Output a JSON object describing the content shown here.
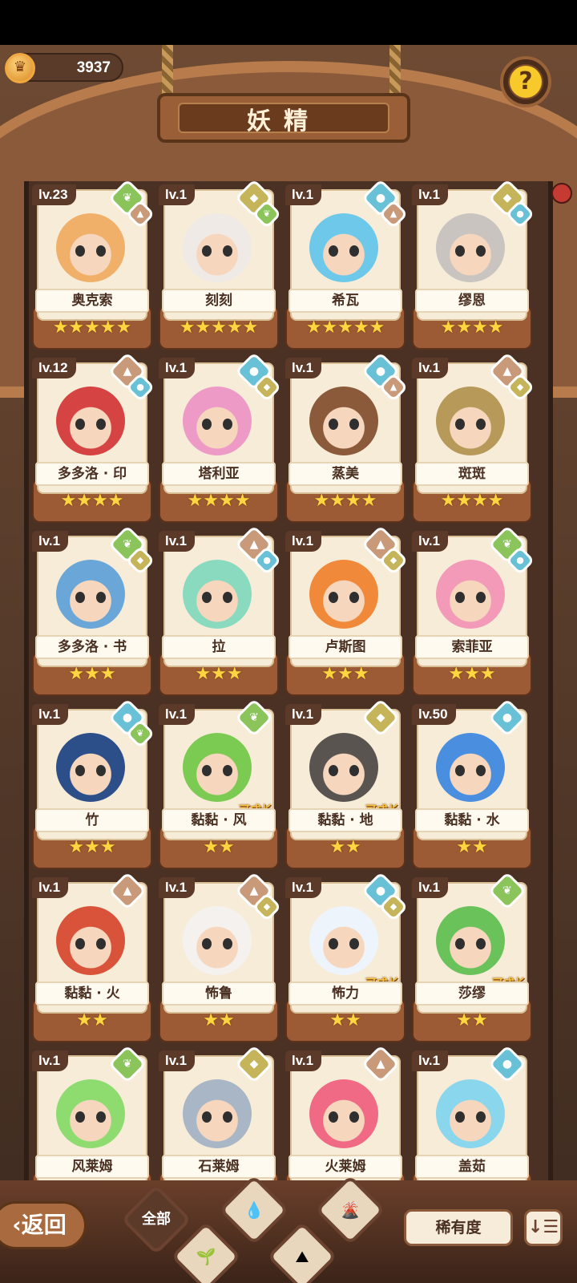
{
  "currency": {
    "amount": "3937",
    "icon": "coin-icon"
  },
  "header": {
    "title": "妖精"
  },
  "help": {
    "label": "?"
  },
  "cards": [
    {
      "name": "奥克索",
      "level": "lv.23",
      "stars": "★★★★★",
      "elements": [
        "wind",
        "fire"
      ],
      "grow": "",
      "color": "#f0b06a"
    },
    {
      "name": "刻刻",
      "level": "lv.1",
      "stars": "★★★★★",
      "elements": [
        "earth",
        "wind"
      ],
      "grow": "",
      "color": "#efeae6"
    },
    {
      "name": "希瓦",
      "level": "lv.1",
      "stars": "★★★★★",
      "elements": [
        "water",
        "fire"
      ],
      "grow": "",
      "color": "#6ec8ea"
    },
    {
      "name": "缪恩",
      "level": "lv.1",
      "stars": "★★★★",
      "elements": [
        "earth",
        "water"
      ],
      "grow": "",
      "color": "#c9c4bf"
    },
    {
      "name": "多多洛 · 印",
      "level": "lv.12",
      "stars": "★★★★",
      "elements": [
        "fire",
        "water"
      ],
      "grow": "",
      "color": "#d64343"
    },
    {
      "name": "塔利亚",
      "level": "lv.1",
      "stars": "★★★★",
      "elements": [
        "water",
        "earth"
      ],
      "grow": "",
      "color": "#ee9ac6"
    },
    {
      "name": "蒸美",
      "level": "lv.1",
      "stars": "★★★★",
      "elements": [
        "water",
        "fire"
      ],
      "grow": "",
      "color": "#8a5a3b"
    },
    {
      "name": "斑斑",
      "level": "lv.1",
      "stars": "★★★★",
      "elements": [
        "fire",
        "earth"
      ],
      "grow": "",
      "color": "#b79a5a"
    },
    {
      "name": "多多洛 · 书",
      "level": "lv.1",
      "stars": "★★★",
      "elements": [
        "wind",
        "earth"
      ],
      "grow": "",
      "color": "#6aa6d8"
    },
    {
      "name": "拉",
      "level": "lv.1",
      "stars": "★★★",
      "elements": [
        "fire",
        "water"
      ],
      "grow": "",
      "color": "#8adac0"
    },
    {
      "name": "卢斯图",
      "level": "lv.1",
      "stars": "★★★",
      "elements": [
        "fire",
        "earth"
      ],
      "grow": "",
      "color": "#f08a3a"
    },
    {
      "name": "索菲亚",
      "level": "lv.1",
      "stars": "★★★",
      "elements": [
        "wind",
        "water"
      ],
      "grow": "",
      "color": "#f29ab8"
    },
    {
      "name": "竹",
      "level": "lv.1",
      "stars": "★★★",
      "elements": [
        "water",
        "wind"
      ],
      "grow": "",
      "color": "#2c4f8a"
    },
    {
      "name": "黏黏 · 风",
      "level": "lv.1",
      "stars": "★★",
      "elements": [
        "wind"
      ],
      "grow": "可成长",
      "color": "#7bcb52"
    },
    {
      "name": "黏黏 · 地",
      "level": "lv.1",
      "stars": "★★",
      "elements": [
        "earth"
      ],
      "grow": "可成长",
      "color": "#5a5450"
    },
    {
      "name": "黏黏 · 水",
      "level": "lv.50",
      "stars": "★★",
      "elements": [
        "water"
      ],
      "grow": "",
      "color": "#4a8ee0"
    },
    {
      "name": "黏黏 · 火",
      "level": "lv.1",
      "stars": "★★",
      "elements": [
        "fire"
      ],
      "grow": "",
      "color": "#d8533a"
    },
    {
      "name": "怖鲁",
      "level": "lv.1",
      "stars": "★★",
      "elements": [
        "fire",
        "earth"
      ],
      "grow": "",
      "color": "#f4f1ee"
    },
    {
      "name": "怖力",
      "level": "lv.1",
      "stars": "★★",
      "elements": [
        "water",
        "earth"
      ],
      "grow": "可成长",
      "color": "#eef4fb"
    },
    {
      "name": "莎缪",
      "level": "lv.1",
      "stars": "★★",
      "elements": [
        "wind"
      ],
      "grow": "可成长",
      "color": "#6ac25a"
    },
    {
      "name": "风莱姆",
      "level": "lv.1",
      "stars": "",
      "elements": [
        "wind"
      ],
      "grow": "",
      "color": "#8edc70"
    },
    {
      "name": "石莱姆",
      "level": "lv.1",
      "stars": "",
      "elements": [
        "earth"
      ],
      "grow": "",
      "color": "#a8b6c6"
    },
    {
      "name": "火莱姆",
      "level": "lv.1",
      "stars": "",
      "elements": [
        "fire"
      ],
      "grow": "",
      "color": "#f06a86"
    },
    {
      "name": "盖茹",
      "level": "lv.1",
      "stars": "",
      "elements": [
        "water"
      ],
      "grow": "",
      "color": "#8ad6ec"
    }
  ],
  "bottom": {
    "back_label": "‹返回",
    "filters": [
      {
        "label": "全部",
        "icon": "all-filter"
      },
      {
        "label": "",
        "icon": "sprout-icon"
      },
      {
        "label": "",
        "icon": "water-drop-icon"
      },
      {
        "label": "",
        "icon": "mountain-icon"
      },
      {
        "label": "",
        "icon": "volcano-icon"
      }
    ],
    "sort_label": "稀有度",
    "order_label": "↓☰"
  }
}
